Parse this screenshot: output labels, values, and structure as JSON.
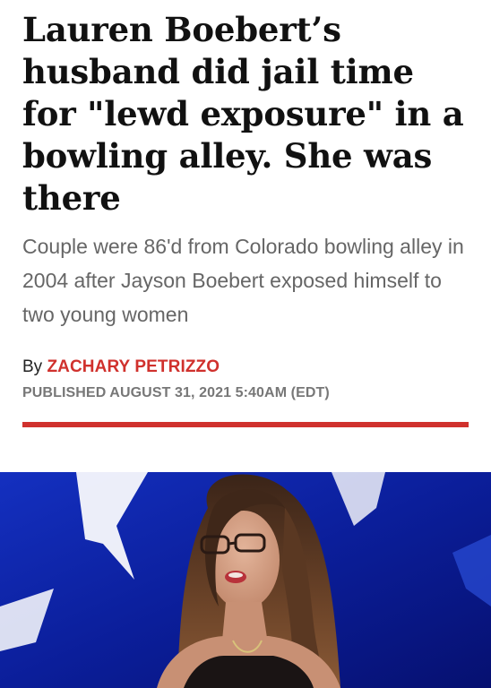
{
  "article": {
    "headline": "Lauren Boebert’s husband did jail time for \"lewd exposure\" in a bowling alley. She was there",
    "subheadline": "Couple were 86'd from Colorado bowling alley in 2004 after Jayson Boebert exposed himself to two young women",
    "byline_prefix": "By ",
    "author": "ZACHARY PETRIZZO",
    "published": "PUBLISHED AUGUST 31, 2021 5:40AM (EDT)"
  },
  "colors": {
    "accent": "#d0312d",
    "photo_background": "#0a1a8c"
  }
}
